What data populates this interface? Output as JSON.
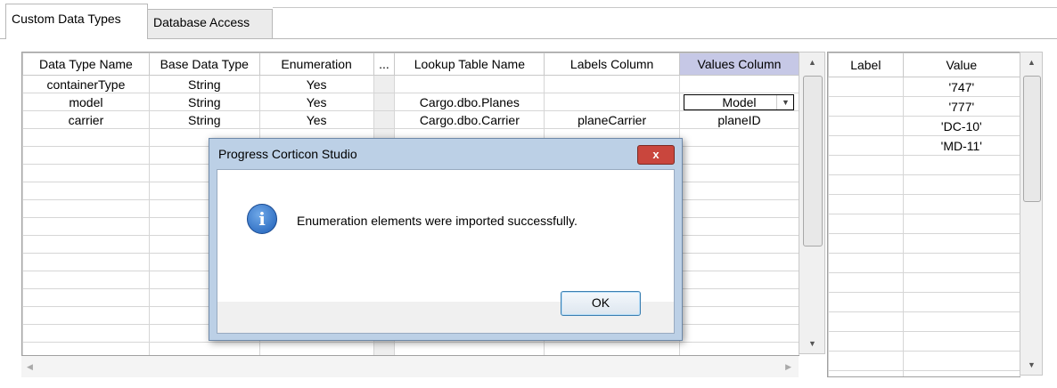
{
  "tabs": [
    {
      "label": "Custom Data Types"
    },
    {
      "label": "Database Access"
    }
  ],
  "main_grid": {
    "columns": [
      "Data Type Name",
      "Base Data Type",
      "Enumeration",
      "...",
      "Lookup Table Name",
      "Labels Column",
      "Values Column"
    ],
    "rows": [
      {
        "name": "containerType",
        "base": "String",
        "enum": "Yes",
        "lookup": "",
        "labels": "",
        "values": ""
      },
      {
        "name": "model",
        "base": "String",
        "enum": "Yes",
        "lookup": "Cargo.dbo.Planes",
        "labels": "",
        "values": "Model"
      },
      {
        "name": "carrier",
        "base": "String",
        "enum": "Yes",
        "lookup": "Cargo.dbo.Carrier",
        "labels": "planeCarrier",
        "values": "planeID"
      }
    ]
  },
  "enum_grid": {
    "columns": [
      "Label",
      "Value"
    ],
    "rows": [
      {
        "label": "",
        "value": "'747'"
      },
      {
        "label": "",
        "value": "'777'"
      },
      {
        "label": "",
        "value": "'DC-10'"
      },
      {
        "label": "",
        "value": "'MD-11'"
      }
    ]
  },
  "dialog": {
    "title": "Progress Corticon Studio",
    "close_glyph": "x",
    "message": "Enumeration elements were imported successfully.",
    "ok_label": "OK",
    "icon": "info-icon"
  },
  "colors": {
    "selected_header": "#c6c8e6",
    "dialog_frame": "#bcd0e6",
    "close_button": "#c9463d"
  }
}
